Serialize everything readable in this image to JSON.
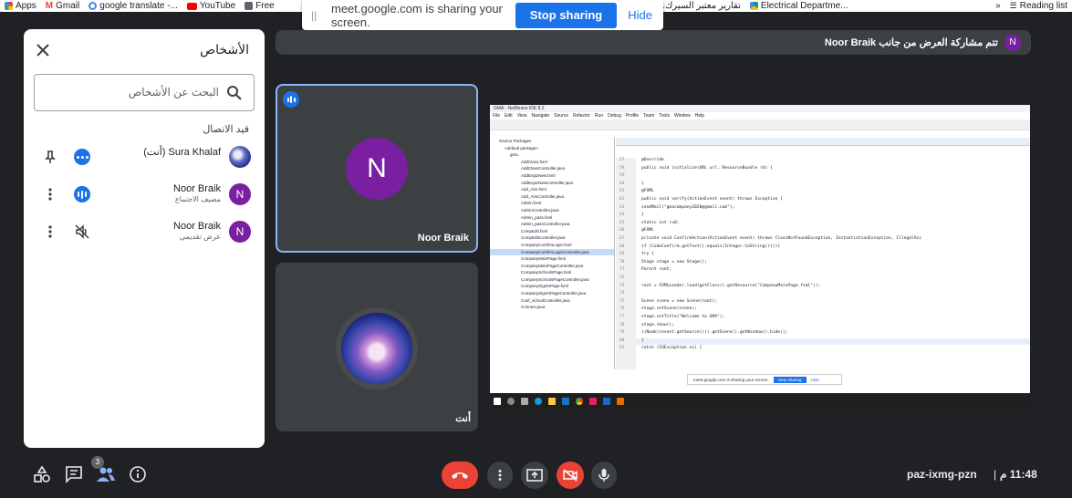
{
  "bookmarks": {
    "items": [
      {
        "label": "Apps"
      },
      {
        "label": "Gmail"
      },
      {
        "label": "google translate -..."
      },
      {
        "label": "YouTube"
      },
      {
        "label": "Free"
      },
      {
        "label": "تقارير معتبر السيرك..."
      },
      {
        "label": "Electrical Departme..."
      }
    ],
    "more": "»",
    "reading_list": "Reading list"
  },
  "share_bar": {
    "message": "meet.google.com is sharing your screen.",
    "stop_label": "Stop sharing",
    "hide_label": "Hide"
  },
  "people_panel": {
    "title": "الأشخاص",
    "search_placeholder": "البحث عن الأشخاص",
    "section_label": "قيد الاتصال",
    "people": [
      {
        "initial": "",
        "name": "Sura Khalaf (أنت)",
        "subtitle": ""
      },
      {
        "initial": "N",
        "name": "Noor Braik",
        "subtitle": "مضيف الاجتماع"
      },
      {
        "initial": "N",
        "name": "Noor Braik",
        "subtitle": "عرض تقديمي"
      }
    ]
  },
  "presenting_banner": {
    "initial": "N",
    "text": "تتم مشاركة العرض من جانب Noor Braik"
  },
  "tiles": {
    "main": {
      "initial": "N",
      "name": "Noor Braik"
    },
    "self": {
      "name": "أنت"
    }
  },
  "shared_screen": {
    "window_title": "GMA - NetBeans IDE 8.2",
    "menu": [
      "File",
      "Edit",
      "View",
      "Navigate",
      "Source",
      "Refactor",
      "Run",
      "Debug",
      "Profile",
      "Team",
      "Tools",
      "Window",
      "Help"
    ],
    "files": [
      "Source Packages",
      "<default package>",
      "gma",
      "AddClass.fxml",
      "AddClassController.java",
      "AddEnjazNew.fxml",
      "AddEnjazNewController.java",
      "Add_Aim.fxml",
      "Add_AimController.java",
      "Admin.fxml",
      "AdminController.java",
      "Admin_pass.fxml",
      "Admin_passController.java",
      "CompEdit.fxml",
      "CompEditController.java",
      "CompanyConfirmLogin.fxml",
      "CompanyConfirmLoginController.java",
      "CompanyMainPage.fxml",
      "CompanyMainPageController.java",
      "CompanySchoolsPage.fxml",
      "CompanySchoolsPageController.java",
      "CompanySignInPage.fxml",
      "CompanySignInPageController.java",
      "Conf_schoolController.java",
      "Connect.java"
    ],
    "selected_file": "CompanyConfirmLoginController.java",
    "code": [
      {
        "n": "57",
        "t": "@Override"
      },
      {
        "n": "58",
        "t": "public void initialize(URL url, ResourceBundle rb) {"
      },
      {
        "n": "59",
        "t": ""
      },
      {
        "n": "60",
        "t": "}"
      },
      {
        "n": "61",
        "t": "@FXML"
      },
      {
        "n": "62",
        "t": "public void verify(ActionEvent event) throws Exception {"
      },
      {
        "n": "63",
        "t": "    sendMail(\"gmacompany2020@gmail.com\");"
      },
      {
        "n": "64",
        "t": "}"
      },
      {
        "n": "65",
        "t": "    static int r=0;"
      },
      {
        "n": "66",
        "t": "  @FXML"
      },
      {
        "n": "67",
        "t": "  private void ConfirmAction(ActionEvent event) throws ClassNotFoundException, InstantiationException, IllegalAcc"
      },
      {
        "n": "68",
        "t": "  if (CodeConfirm.getText().equals(Integer.toString(r))){"
      },
      {
        "n": "69",
        "t": "     try {"
      },
      {
        "n": "70",
        "t": "       Stage stage = new Stage();"
      },
      {
        "n": "71",
        "t": "       Parent root;"
      },
      {
        "n": "72",
        "t": ""
      },
      {
        "n": "73",
        "t": "       root = FXMLLoader.load(getClass().getResource(\"CompanyMainPage.fxml\"));"
      },
      {
        "n": "74",
        "t": ""
      },
      {
        "n": "75",
        "t": "       Scene scene = new Scene(root);"
      },
      {
        "n": "76",
        "t": "       stage.setScene(scene);"
      },
      {
        "n": "77",
        "t": "       stage.setTitle(\"Welcome to GMA\");"
      },
      {
        "n": "78",
        "t": "       stage.show();"
      },
      {
        "n": "79",
        "t": "       ((Node)(event.getSource())).getScene().getWindow().hide();"
      },
      {
        "n": "80",
        "t": "     }"
      },
      {
        "n": "81",
        "t": "     catch (IOException ex) {"
      }
    ],
    "inner_share_msg": "meet.google.com is sharing your screen.",
    "inner_stop": "Stop sharing",
    "inner_hide": "Hide"
  },
  "bottom_bar": {
    "participants_badge": "3",
    "meeting_code": "paz-ixmg-pzn",
    "separator": "|",
    "clock": "11:48 م"
  },
  "colors": {
    "background": "#202124",
    "tile": "#3c4043",
    "accent_blue": "#1a73e8",
    "avatar_purple": "#7b1fa2",
    "end_call_red": "#ea4335"
  }
}
